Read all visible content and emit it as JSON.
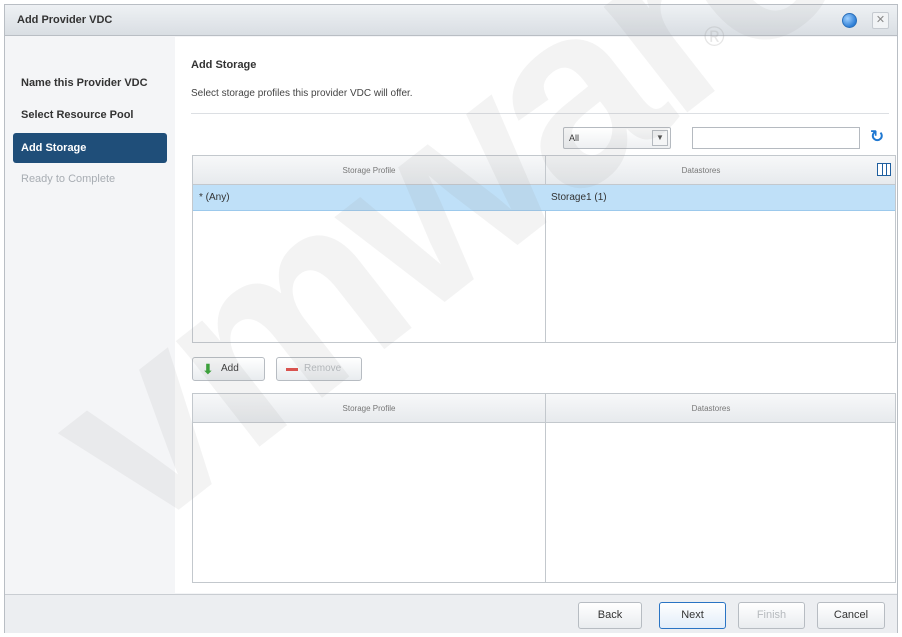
{
  "window": {
    "title": "Add Provider VDC"
  },
  "steps": [
    {
      "label": "Name this Provider VDC",
      "state": "done"
    },
    {
      "label": "Select Resource Pool",
      "state": "done"
    },
    {
      "label": "Add Storage",
      "state": "active"
    },
    {
      "label": "Ready to Complete",
      "state": "disabled"
    }
  ],
  "page": {
    "heading": "Add Storage",
    "description": "Select storage profiles this provider VDC will offer."
  },
  "filter": {
    "selected": "All",
    "search_value": ""
  },
  "available_table": {
    "columns": [
      "Storage Profile",
      "Datastores"
    ],
    "rows": [
      {
        "storage_profile": "* (Any)",
        "datastores": "Storage1 (1)",
        "selected": true
      }
    ]
  },
  "actions": {
    "add_label": "Add",
    "remove_label": "Remove"
  },
  "selected_table": {
    "columns": [
      "Storage Profile",
      "Datastores"
    ],
    "rows": []
  },
  "footer": {
    "back_label": "Back",
    "next_label": "Next",
    "finish_label": "Finish",
    "cancel_label": "Cancel"
  },
  "watermark": {
    "text": "vmware",
    "mark": "®"
  },
  "colors": {
    "active_step": "#1f4e79",
    "selected_row": "#bfe0f8",
    "primary_border": "#2a74c4",
    "add_icon": "#2fa12f",
    "remove_icon": "#d9534f"
  }
}
